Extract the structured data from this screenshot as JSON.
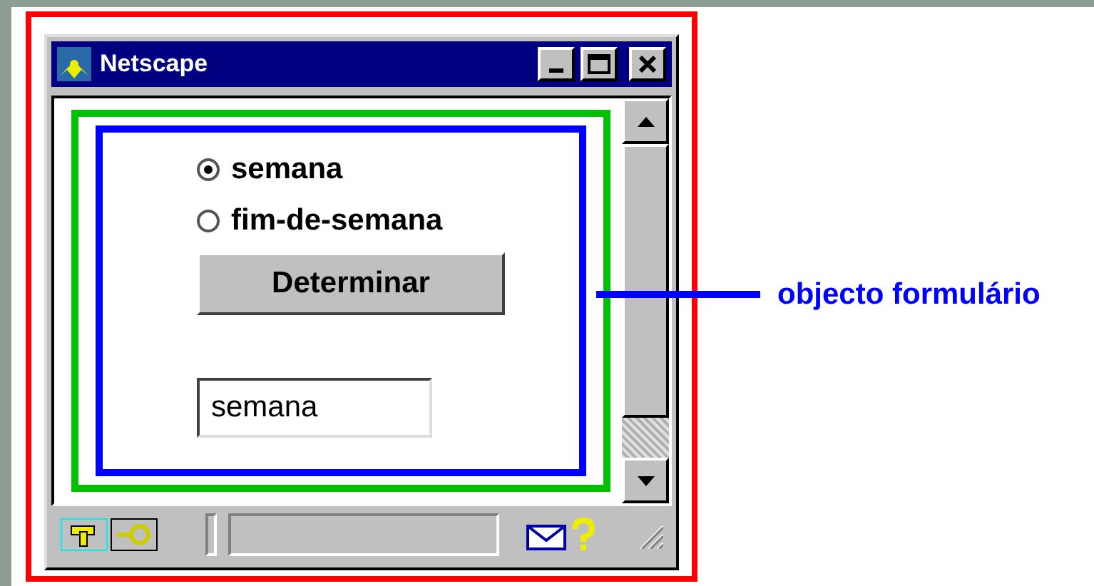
{
  "window": {
    "title": "Netscape"
  },
  "form": {
    "radios": [
      {
        "label": "semana",
        "selected": true
      },
      {
        "label": "fim-de-semana",
        "selected": false
      }
    ],
    "button": "Determinar",
    "field_value": "semana"
  },
  "annotation": {
    "label": "objecto formulário"
  }
}
